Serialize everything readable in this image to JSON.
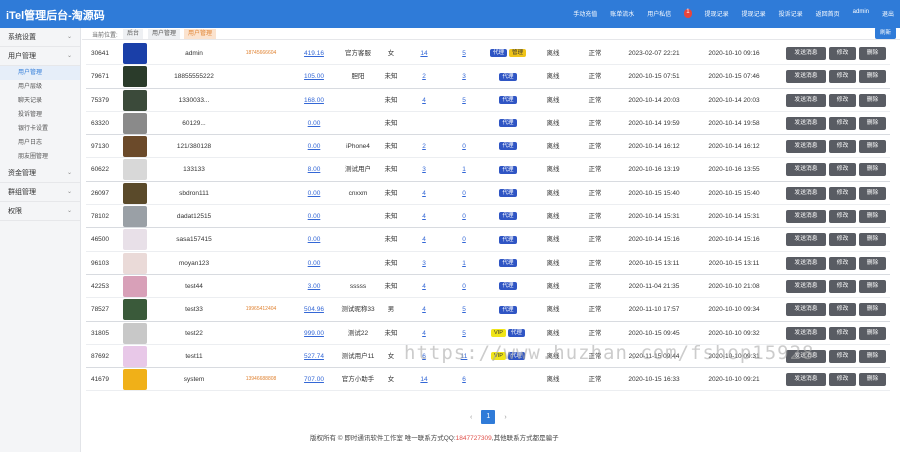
{
  "header": {
    "title": "iTel管理后台-淘源码",
    "nav": [
      "手动充值",
      "账单流水",
      "用户私信",
      "提现记录",
      "提现记录",
      "投诉记录",
      "返回首页",
      "admin",
      "退出"
    ],
    "message_badge": "1",
    "bg_color": "#2f7bd8"
  },
  "sidebar": {
    "groups": [
      {
        "label": "系统设置"
      },
      {
        "label": "用户管理",
        "items": [
          "用户管理",
          "用户层级",
          "聊天记录",
          "投诉管理",
          "银行卡设置",
          "用户日志",
          "朋友圈管理"
        ]
      },
      {
        "label": "资金管理"
      },
      {
        "label": "群组管理"
      },
      {
        "label": "权限"
      }
    ],
    "active_item": "用户管理"
  },
  "breadcrumb": {
    "label": "当前位置:",
    "items": [
      "后台",
      "用户管理",
      "用户管理"
    ]
  },
  "refresh_label": "刷新",
  "actions": {
    "message": "发送消息",
    "edit": "修改",
    "delete": "删除"
  },
  "tag_labels": {
    "agent": "代理",
    "manager": "管理",
    "vip": "VIP"
  },
  "rows": [
    {
      "id": "30641",
      "username": "admin",
      "phone": "18745666604",
      "balance": "419.16",
      "nickname": "官方客服",
      "gender": "女",
      "friends": "14",
      "groups": "5",
      "tags": [
        "agent",
        "manager"
      ],
      "online": "离线",
      "status": "正常",
      "created": "2023-02-07 22:21",
      "last": "2020-10-10 09:16"
    },
    {
      "id": "79671",
      "username": "18855555222",
      "phone": "",
      "balance": "105.00",
      "nickname": "胆阳",
      "gender": "未知",
      "friends": "2",
      "groups": "3",
      "tags": [
        "agent"
      ],
      "online": "离线",
      "status": "正常",
      "created": "2020-10-15 07:51",
      "last": "2020-10-15 07:46"
    },
    {
      "id": "75379",
      "username": "1330033...",
      "phone": "",
      "balance": "168.00",
      "nickname": "",
      "gender": "未知",
      "friends": "4",
      "groups": "5",
      "tags": [
        "agent"
      ],
      "online": "离线",
      "status": "正常",
      "created": "2020-10-14 20:03",
      "last": "2020-10-14 20:03"
    },
    {
      "id": "63320",
      "username": "60129...",
      "phone": "",
      "balance": "0.00",
      "nickname": "",
      "gender": "未知",
      "friends": "",
      "groups": "",
      "tags": [
        "agent"
      ],
      "online": "离线",
      "status": "正常",
      "created": "2020-10-14 19:59",
      "last": "2020-10-14 19:58"
    },
    {
      "id": "97130",
      "username": "121/380128",
      "phone": "",
      "balance": "0.00",
      "nickname": "iPhone4",
      "gender": "未知",
      "friends": "2",
      "groups": "0",
      "tags": [
        "agent"
      ],
      "online": "离线",
      "status": "正常",
      "created": "2020-10-14 16:12",
      "last": "2020-10-14 16:12"
    },
    {
      "id": "60622",
      "username": "133133",
      "phone": "",
      "balance": "8.00",
      "nickname": "测试用户",
      "gender": "未知",
      "friends": "3",
      "groups": "1",
      "tags": [
        "agent"
      ],
      "online": "离线",
      "status": "正常",
      "created": "2020-10-16 13:19",
      "last": "2020-10-16 13:55"
    },
    {
      "id": "26097",
      "username": "sbdron111",
      "phone": "",
      "balance": "0.00",
      "nickname": "cnxxm",
      "gender": "未知",
      "friends": "4",
      "groups": "0",
      "tags": [
        "agent"
      ],
      "online": "离线",
      "status": "正常",
      "created": "2020-10-15 15:40",
      "last": "2020-10-15 15:40"
    },
    {
      "id": "78102",
      "username": "dadat12515",
      "phone": "",
      "balance": "0.00",
      "nickname": "",
      "gender": "未知",
      "friends": "4",
      "groups": "0",
      "tags": [
        "agent"
      ],
      "online": "离线",
      "status": "正常",
      "created": "2020-10-14 15:31",
      "last": "2020-10-14 15:31"
    },
    {
      "id": "46500",
      "username": "sasa157415",
      "phone": "",
      "balance": "0.00",
      "nickname": "",
      "gender": "未知",
      "friends": "4",
      "groups": "0",
      "tags": [
        "agent"
      ],
      "online": "离线",
      "status": "正常",
      "created": "2020-10-14 15:16",
      "last": "2020-10-14 15:16"
    },
    {
      "id": "96103",
      "username": "moyan123",
      "phone": "",
      "balance": "0.00",
      "nickname": "",
      "gender": "未知",
      "friends": "3",
      "groups": "1",
      "tags": [
        "agent"
      ],
      "online": "离线",
      "status": "正常",
      "created": "2020-10-15 13:11",
      "last": "2020-10-15 13:11"
    },
    {
      "id": "42253",
      "username": "test44",
      "phone": "",
      "balance": "3.00",
      "nickname": "sssss",
      "gender": "未知",
      "friends": "4",
      "groups": "0",
      "tags": [
        "agent"
      ],
      "online": "离线",
      "status": "正常",
      "created": "2020-11-04 21:35",
      "last": "2020-10-10 21:08"
    },
    {
      "id": "78527",
      "username": "test33",
      "phone": "19965412404",
      "balance": "504.96",
      "nickname": "测试昵称33",
      "gender": "男",
      "friends": "4",
      "groups": "5",
      "tags": [
        "agent"
      ],
      "online": "离线",
      "status": "正常",
      "created": "2020-11-10 17:57",
      "last": "2020-10-10 09:34"
    },
    {
      "id": "31805",
      "username": "test22",
      "phone": "",
      "balance": "999.00",
      "nickname": "测试22",
      "gender": "未知",
      "friends": "4",
      "groups": "5",
      "tags": [
        "vip",
        "agent"
      ],
      "online": "离线",
      "status": "正常",
      "created": "2020-10-15 09:45",
      "last": "2020-10-10 09:32"
    },
    {
      "id": "87692",
      "username": "test11",
      "phone": "",
      "balance": "527.74",
      "nickname": "测试用户11",
      "gender": "女",
      "friends": "6",
      "groups": "11",
      "tags": [
        "vip",
        "agent"
      ],
      "online": "离线",
      "status": "正常",
      "created": "2020-11-15 09:44",
      "last": "2020-10-10 09:31"
    },
    {
      "id": "41679",
      "username": "system",
      "phone": "13946688808",
      "balance": "707.00",
      "nickname": "官方小助手",
      "gender": "女",
      "friends": "14",
      "groups": "6",
      "tags": [],
      "online": "离线",
      "status": "正常",
      "created": "2020-10-15 16:33",
      "last": "2020-10-10 09:21"
    }
  ],
  "pagination": {
    "prev": "‹",
    "current": "1",
    "next": "›"
  },
  "footer": {
    "text_before": "版权所有 © 即时通讯软件工作室 唯一联系方式QQ:",
    "qq": "1847727309",
    "text_after": ",其他联系方式都是骗子"
  },
  "watermark": "https://www.huzhan.com/fshop15928",
  "avatar_colors": [
    "#1a3fa8",
    "#2a3b2a",
    "#3b4a3a",
    "#8a8a8a",
    "#6b4a2a",
    "#d8d8d8",
    "#5a4a2a",
    "#9aa0a6",
    "#e8e0e8",
    "#eadad8",
    "#d8a0b8",
    "#3a5a3a",
    "#c8c8c8",
    "#e8c8e8",
    "#f0b018"
  ]
}
